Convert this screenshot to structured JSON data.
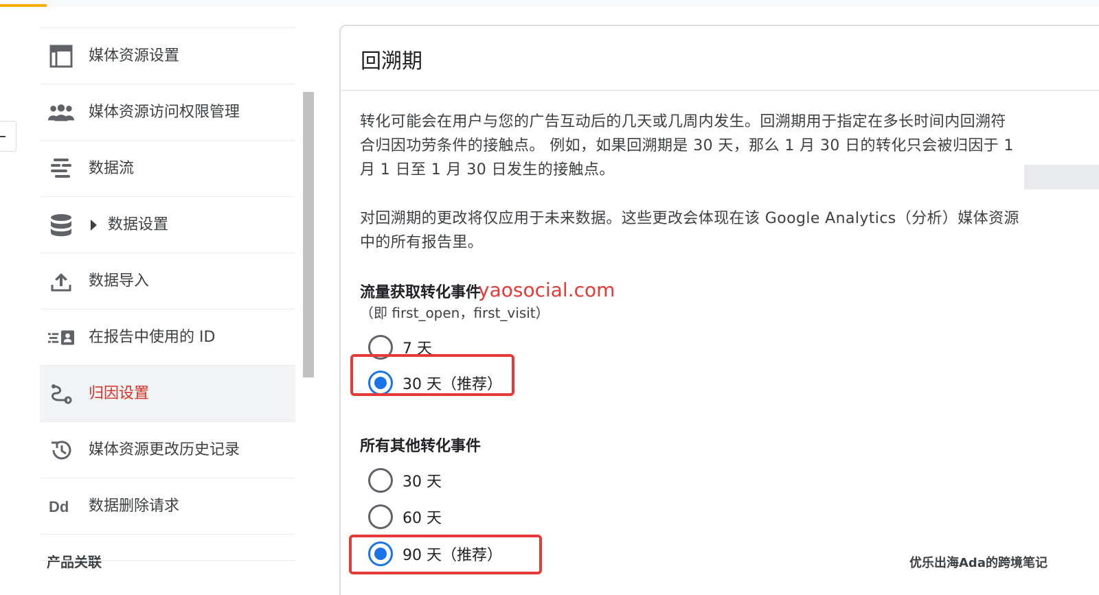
{
  "sidebar": {
    "items": [
      {
        "label": "媒体资源设置",
        "icon": "property-settings-icon"
      },
      {
        "label": "媒体资源访问权限管理",
        "icon": "people-icon"
      },
      {
        "label": "数据流",
        "icon": "data-streams-icon"
      },
      {
        "label": "数据设置",
        "icon": "database-icon"
      },
      {
        "label": "数据导入",
        "icon": "upload-icon"
      },
      {
        "label": "在报告中使用的 ID",
        "icon": "reporting-identity-icon"
      },
      {
        "label": "归因设置",
        "icon": "attribution-icon"
      },
      {
        "label": "媒体资源更改历史记录",
        "icon": "history-icon"
      },
      {
        "label": "数据删除请求",
        "icon": "data-deletion-icon"
      }
    ],
    "section_title": "产品关联"
  },
  "panel": {
    "title": "回溯期",
    "para1": "转化可能会在用户与您的广告互动后的几天或几周内发生。回溯期用于指定在多长时间内回溯符合归因功劳条件的接触点。 例如，如果回溯期是 30 天，那么 1 月 30 日的转化只会被归因于 1 月 1 日至 1 月 30 日发生的接触点。",
    "para2": "对回溯期的更改将仅应用于未来数据。这些更改会体现在该 Google Analytics（分析）媒体资源中的所有报告里。",
    "group1": {
      "title": "流量获取转化事件",
      "subtitle": "（即 first_open，first_visit）",
      "options": [
        {
          "label": "7 天",
          "checked": false
        },
        {
          "label": "30 天（推荐）",
          "checked": true
        }
      ]
    },
    "group2": {
      "title": "所有其他转化事件",
      "options": [
        {
          "label": "30 天",
          "checked": false
        },
        {
          "label": "60 天",
          "checked": false
        },
        {
          "label": "90 天（推荐）",
          "checked": true
        }
      ]
    }
  },
  "overlays": {
    "watermark": "yaosocial.com",
    "corner_mark": "优乐出海Ada的跨境笔记"
  },
  "colors": {
    "accent": "#1a73e8",
    "active_nav": "#d93025",
    "highlight_box": "#e53935",
    "top_accent": "#f9ab00"
  }
}
